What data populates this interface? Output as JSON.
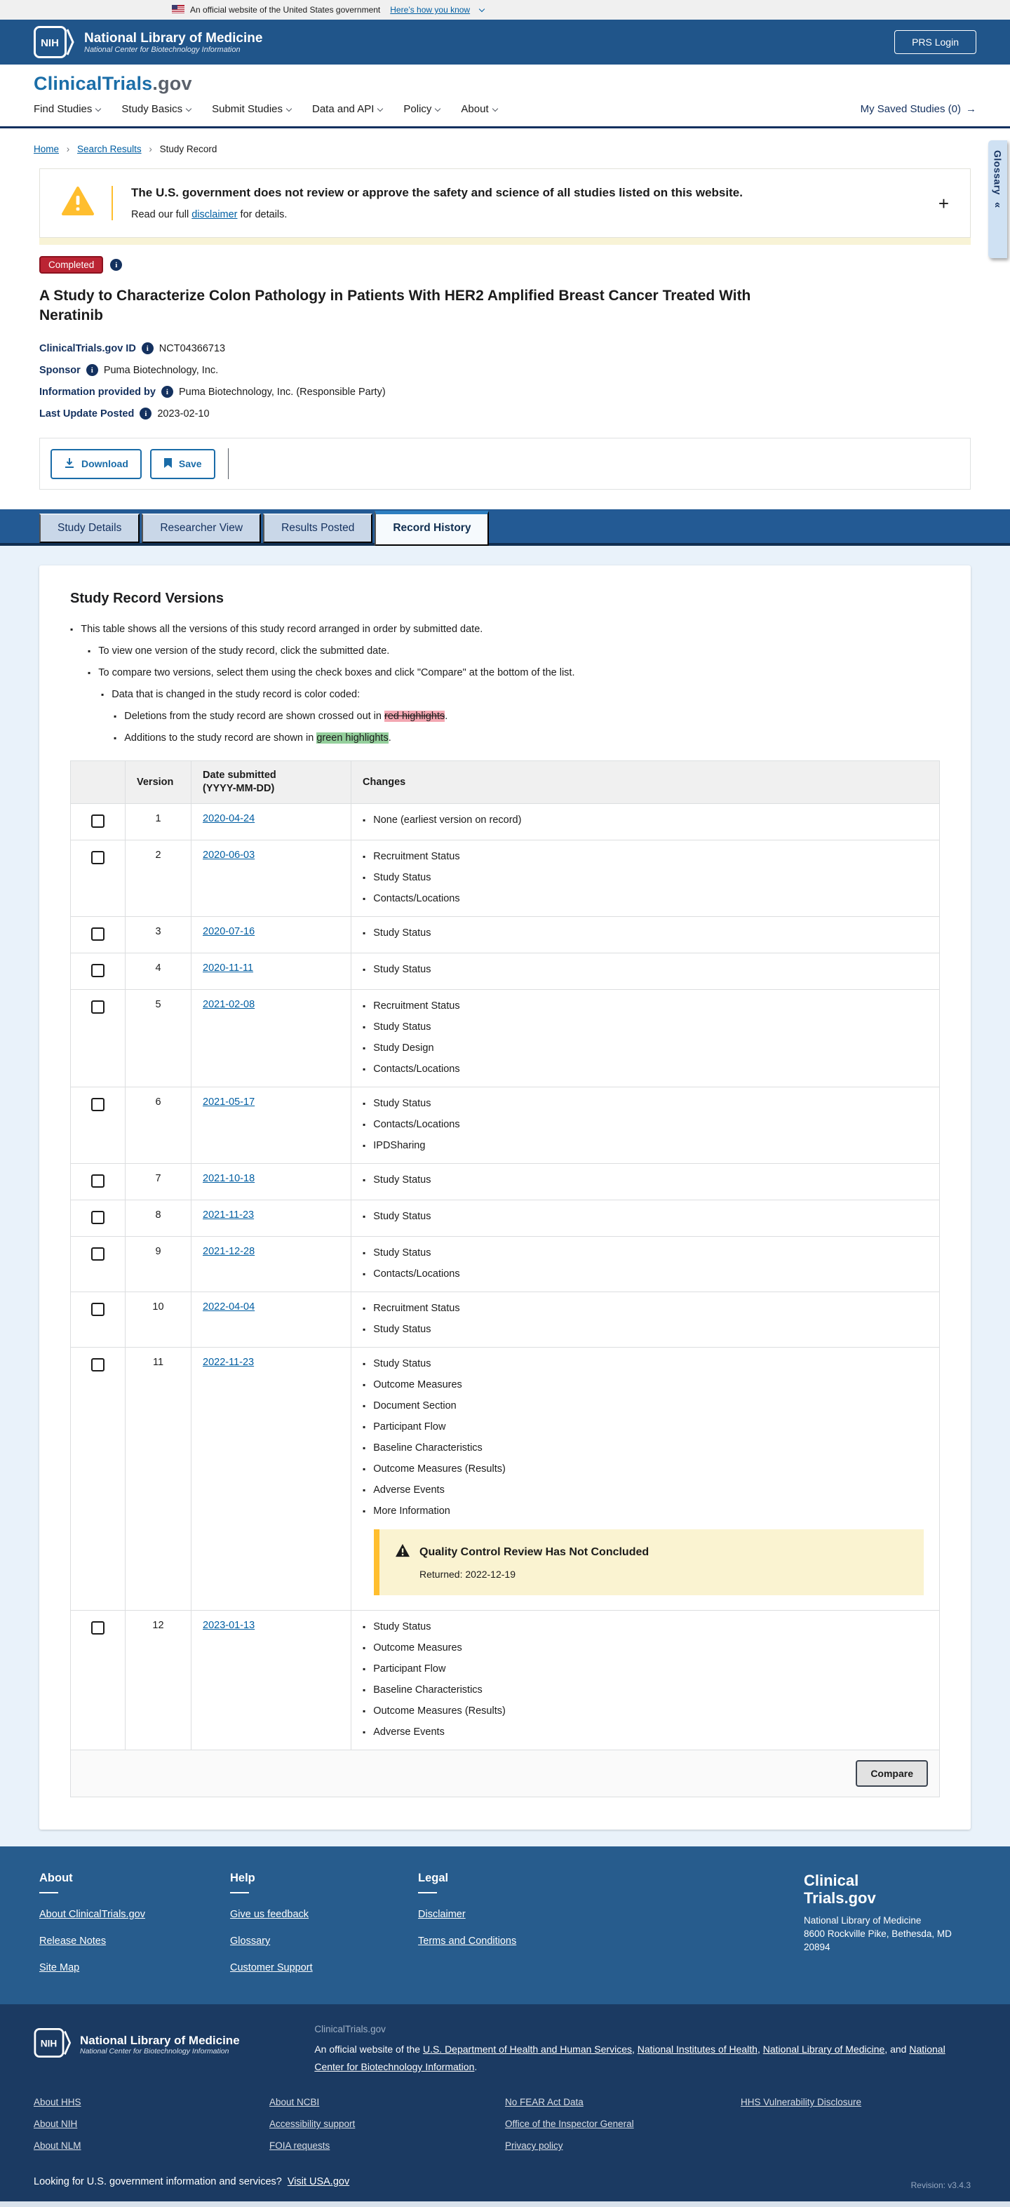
{
  "banner": {
    "text": "An official website of the United States government",
    "link": "Here’s how you know"
  },
  "nih_header": {
    "acronym": "NIH",
    "org": "National Library of Medicine",
    "suborg": "National Center for Biotechnology Information",
    "login_label": "PRS Login"
  },
  "nav": {
    "logo_main": "ClinicalTrials",
    "logo_suffix": ".gov",
    "items": [
      "Find Studies",
      "Study Basics",
      "Submit Studies",
      "Data and API",
      "Policy",
      "About"
    ],
    "saved_label": "My Saved Studies (0)",
    "saved_arrow": "→"
  },
  "breadcrumb": {
    "items": [
      "Home",
      "Search Results",
      "Study Record"
    ]
  },
  "glossary_tab": {
    "label": "Glossary",
    "collapse_icon": "«"
  },
  "alert": {
    "title": "The U.S. government does not review or approve the safety and science of all studies listed on this website.",
    "body_prefix": "Read our full ",
    "link": "disclaimer",
    "body_suffix": " for details.",
    "expand_icon": "+"
  },
  "study": {
    "status": "Completed",
    "title": "A Study to Characterize Colon Pathology in Patients With HER2 Amplified Breast Cancer Treated With Neratinib",
    "meta": [
      {
        "label": "ClinicalTrials.gov ID",
        "value": "NCT04366713"
      },
      {
        "label": "Sponsor",
        "value": "Puma Biotechnology, Inc."
      },
      {
        "label": "Information provided by",
        "value": "Puma Biotechnology, Inc. (Responsible Party)"
      },
      {
        "label": "Last Update Posted",
        "value": "2023-02-10"
      }
    ]
  },
  "actions": {
    "download": "Download",
    "save": "Save"
  },
  "tabs": [
    {
      "label": "Study Details",
      "active": false
    },
    {
      "label": "Researcher View",
      "active": false
    },
    {
      "label": "Results Posted",
      "active": false
    },
    {
      "label": "Record History",
      "active": true
    }
  ],
  "record_history": {
    "heading": "Study Record Versions",
    "intro": {
      "b1": "This table shows all the versions of this study record arranged in order by submitted date.",
      "b2": "To view one version of the study record, click the submitted date.",
      "b3": "To compare two versions, select them using the check boxes and click \"Compare\" at the bottom of the list.",
      "b4": "Data that is changed in the study record is color coded:",
      "b5_prefix": "Deletions from the study record are shown crossed out in ",
      "b5_mark": "red highlights",
      "b5_suffix": ".",
      "b6_prefix": "Additions to the study record are shown in ",
      "b6_mark": "green highlights",
      "b6_suffix": "."
    },
    "table": {
      "headers": {
        "version": "Version",
        "date_line1": "Date submitted",
        "date_line2": "(YYYY-MM-DD)",
        "changes": "Changes"
      },
      "rows": [
        {
          "version": "1",
          "date": "2020-04-24",
          "changes": [
            "None (earliest version on record)"
          ]
        },
        {
          "version": "2",
          "date": "2020-06-03",
          "changes": [
            "Recruitment Status",
            "Study Status",
            "Contacts/Locations"
          ]
        },
        {
          "version": "3",
          "date": "2020-07-16",
          "changes": [
            "Study Status"
          ]
        },
        {
          "version": "4",
          "date": "2020-11-11",
          "changes": [
            "Study Status"
          ]
        },
        {
          "version": "5",
          "date": "2021-02-08",
          "changes": [
            "Recruitment Status",
            "Study Status",
            "Study Design",
            "Contacts/Locations"
          ]
        },
        {
          "version": "6",
          "date": "2021-05-17",
          "changes": [
            "Study Status",
            "Contacts/Locations",
            "IPDSharing"
          ]
        },
        {
          "version": "7",
          "date": "2021-10-18",
          "changes": [
            "Study Status"
          ]
        },
        {
          "version": "8",
          "date": "2021-11-23",
          "changes": [
            "Study Status"
          ]
        },
        {
          "version": "9",
          "date": "2021-12-28",
          "changes": [
            "Study Status",
            "Contacts/Locations"
          ]
        },
        {
          "version": "10",
          "date": "2022-04-04",
          "changes": [
            "Recruitment Status",
            "Study Status"
          ]
        },
        {
          "version": "11",
          "date": "2022-11-23",
          "changes": [
            "Study Status",
            "Outcome Measures",
            "Document Section",
            "Participant Flow",
            "Baseline Characteristics",
            "Outcome Measures (Results)",
            "Adverse Events",
            "More Information"
          ],
          "notice": {
            "title": "Quality Control Review Has Not Concluded",
            "returned": "Returned: 2022-12-19"
          }
        },
        {
          "version": "12",
          "date": "2023-01-13",
          "changes": [
            "Study Status",
            "Outcome Measures",
            "Participant Flow",
            "Baseline Characteristics",
            "Outcome Measures (Results)",
            "Adverse Events"
          ]
        }
      ],
      "compare_label": "Compare"
    }
  },
  "mid_footer": {
    "columns": [
      {
        "heading": "About",
        "links": [
          "About ClinicalTrials.gov",
          "Release Notes",
          "Site Map"
        ]
      },
      {
        "heading": "Help",
        "links": [
          "Give us feedback",
          "Glossary",
          "Customer Support"
        ]
      },
      {
        "heading": "Legal",
        "links": [
          "Disclaimer",
          "Terms and Conditions"
        ]
      }
    ],
    "logo_line1": "Clinical",
    "logo_line2": "Trials.gov",
    "address_lines": [
      "National Library of Medicine",
      "8600 Rockville Pike, Bethesda, MD",
      "20894"
    ]
  },
  "dark_footer": {
    "org": "National Library of Medicine",
    "suborg": "National Center for Biotechnology Information",
    "site_label": "ClinicalTrials.gov",
    "para_segments": [
      {
        "text": "An official website of the "
      },
      {
        "link": "U.S. Department of Health and Human Services"
      },
      {
        "text": ", "
      },
      {
        "link": "National Institutes of Health"
      },
      {
        "text": ", "
      },
      {
        "link": "National Library of Medicine"
      },
      {
        "text": ", and "
      },
      {
        "link": "National Center for Biotechnology Information"
      },
      {
        "text": "."
      }
    ],
    "link_columns": [
      [
        "About HHS",
        "About NIH",
        "About NLM"
      ],
      [
        "About NCBI",
        "Accessibility support",
        "FOIA requests"
      ],
      [
        "No FEAR Act Data",
        "Office of the Inspector General",
        "Privacy policy"
      ],
      [
        "HHS Vulnerability Disclosure"
      ]
    ],
    "usa_text": "Looking for U.S. government information and services?",
    "usa_link": "Visit USA.gov",
    "revision": "Revision: v3.4.3"
  },
  "colors": {
    "header_blue": "#20558a",
    "nav_border_navy": "#14315f",
    "link_blue": "#005ea2",
    "tab_bar_blue": "#235a94",
    "active_tab_accent": "#2d7ec0",
    "status_badge_red": "#bb2433",
    "warning_yellow": "#ffbe2e",
    "qc_notice_bg": "#faf3d1",
    "red_highlight": "#f3a7b2",
    "green_highlight": "#94cf9c",
    "mid_footer_blue": "#275c8d",
    "dark_footer_navy": "#1b3a62"
  }
}
